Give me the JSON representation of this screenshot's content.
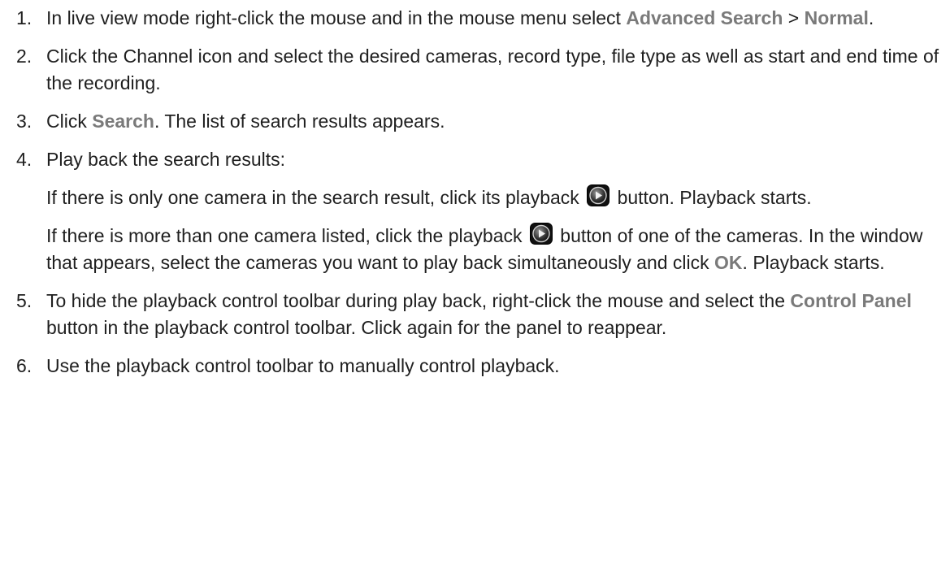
{
  "steps": [
    {
      "number": "1.",
      "t1": "In live view mode right-click the mouse and in the mouse menu select ",
      "ui1": "Advanced Search",
      "t2": " > ",
      "ui2": "Normal",
      "t3": "."
    },
    {
      "number": "2.",
      "text": "Click the Channel icon and select the desired cameras, record type, file type as well as start and end time of the recording."
    },
    {
      "number": "3.",
      "t1": "Click ",
      "ui1": "Search",
      "t2": ". The list of search results appears."
    },
    {
      "number": "4.",
      "text": "Play back the search results:",
      "sub1": {
        "t1": "If there is only one camera in the search result, click its playback ",
        "icon": "playback-icon",
        "t2": " button. Playback starts."
      },
      "sub2": {
        "t1": "If there is more than one camera listed, click the playback ",
        "icon": "playback-icon",
        "t2": " button of one of the cameras. In the window that appears, select the cameras you want to play back simultaneously and click ",
        "ui1": "OK",
        "t3": ". Playback starts."
      }
    },
    {
      "number": "5.",
      "t1": "To hide the playback control toolbar during play back, right-click the mouse and select the ",
      "ui1": "Control Panel",
      "t2": " button in the playback control toolbar. Click again for the panel to reappear."
    },
    {
      "number": "6.",
      "text": "Use the playback control toolbar to manually control playback."
    }
  ],
  "colors": {
    "body_text": "#1f1f1f",
    "ui_term": "#7a7a7a"
  }
}
